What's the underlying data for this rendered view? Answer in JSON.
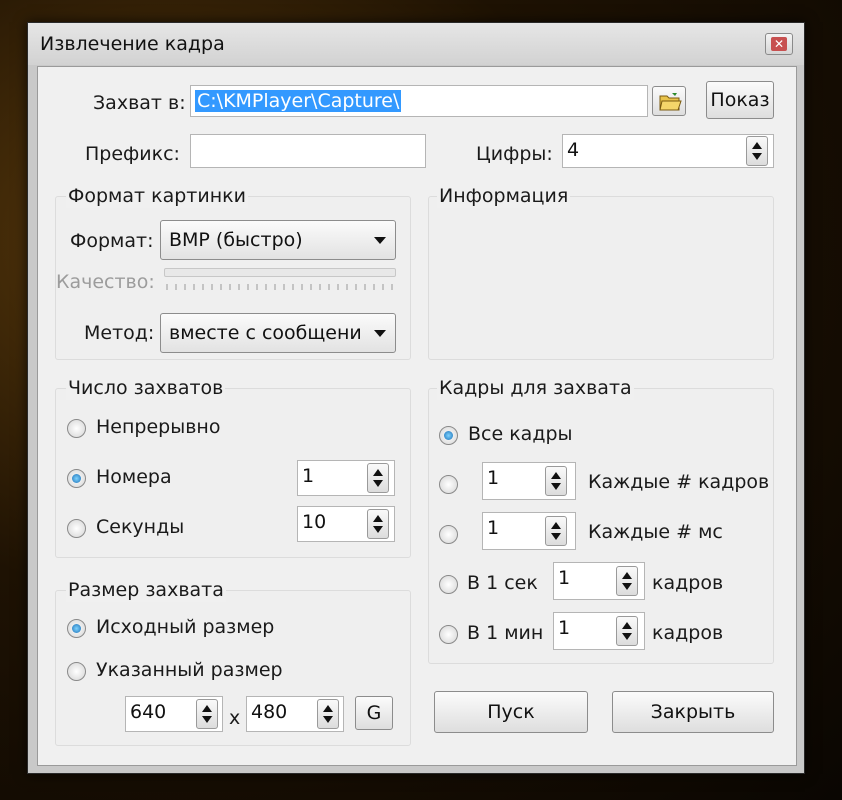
{
  "window": {
    "title": "Извлечение кадра",
    "close_glyph": "✕"
  },
  "capture_to": {
    "label": "Захват в:",
    "value": "C:\\KMPlayer\\Capture\\",
    "show_button": "Показ"
  },
  "prefix": {
    "label": "Префикс:",
    "value": ""
  },
  "digits": {
    "label": "Цифры:",
    "value": "4"
  },
  "image_format": {
    "group_title": "Формат картинки",
    "format_label": "Формат:",
    "format_value": "BMP (быстро)",
    "quality_label": "Качество:",
    "method_label": "Метод:",
    "method_value": "вместе с сообщени"
  },
  "info": {
    "group_title": "Информация"
  },
  "capture_count": {
    "group_title": "Число захватов",
    "continuous": "Непрерывно",
    "numbers": "Номера",
    "numbers_value": "1",
    "seconds": "Секунды",
    "seconds_value": "10"
  },
  "frames_to_capture": {
    "group_title": "Кадры для захвата",
    "all_frames": "Все кадры",
    "every_n_frames_value": "1",
    "every_n_frames": "Каждые # кадров",
    "every_n_ms_value": "1",
    "every_n_ms": "Каждые # мс",
    "per_sec_label": "В 1 сек",
    "per_sec_value": "1",
    "per_sec_unit": "кадров",
    "per_min_label": "В 1 мин",
    "per_min_value": "1",
    "per_min_unit": "кадров"
  },
  "capture_size": {
    "group_title": "Размер захвата",
    "original": "Исходный размер",
    "specified": "Указанный размер",
    "width": "640",
    "times": "x",
    "height": "480",
    "g_button": "G"
  },
  "actions": {
    "start": "Пуск",
    "close": "Закрыть"
  },
  "colors": {
    "selection": "#3399ff",
    "radio_selected": "#1a6fb5",
    "close_button": "#c75050"
  },
  "icons": {
    "browse": "folder-open-icon"
  }
}
